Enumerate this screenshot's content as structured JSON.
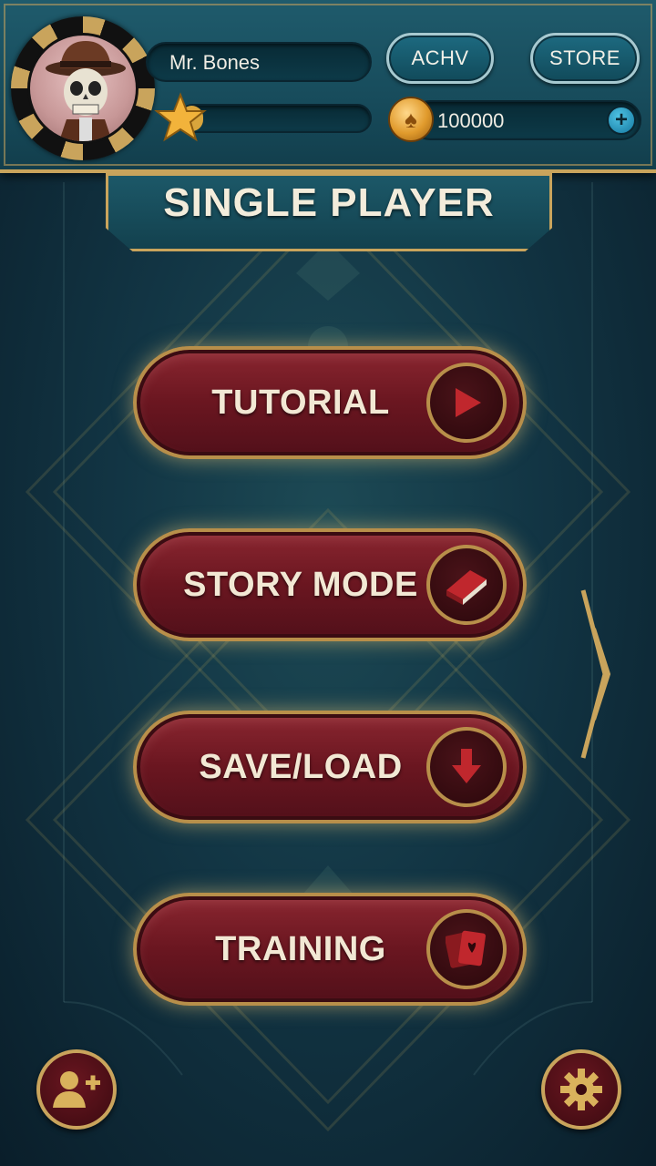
{
  "header": {
    "player_name": "Mr. Bones",
    "achievements_label": "ACHV",
    "store_label": "STORE",
    "coins": "100000",
    "xp_progress": 0.12
  },
  "title": "SINGLE PLAYER",
  "menu": [
    {
      "label": "TUTORIAL",
      "icon": "play-icon"
    },
    {
      "label": "STORY MODE",
      "icon": "book-icon"
    },
    {
      "label": "SAVE/LOAD",
      "icon": "download-arrow-icon"
    },
    {
      "label": "TRAINING",
      "icon": "cards-icon"
    }
  ],
  "footer": {
    "left_icon": "add-friend-icon",
    "right_icon": "gear-icon"
  },
  "colors": {
    "accent_gold": "#c9a45c",
    "button_red": "#6a1620",
    "header_teal": "#1f5b6c",
    "icon_red": "#c0272d"
  }
}
